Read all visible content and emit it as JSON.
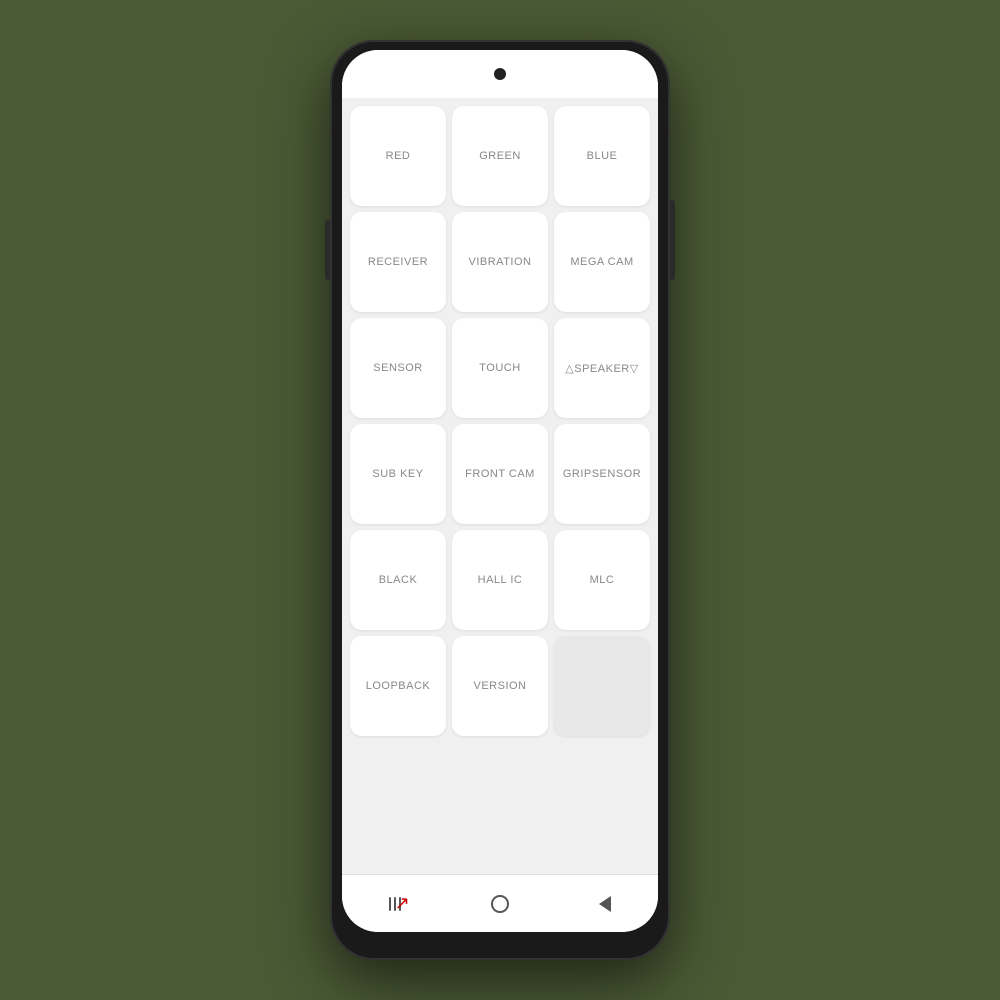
{
  "phone": {
    "background": "#4a5a35"
  },
  "grid": {
    "items": [
      {
        "id": "red",
        "label": "RED",
        "empty": false
      },
      {
        "id": "green",
        "label": "GREEN",
        "empty": false
      },
      {
        "id": "blue",
        "label": "BLUE",
        "empty": false
      },
      {
        "id": "receiver",
        "label": "RECEIVER",
        "empty": false
      },
      {
        "id": "vibration",
        "label": "VIBRATION",
        "empty": false
      },
      {
        "id": "mega-cam",
        "label": "MEGA CAM",
        "empty": false
      },
      {
        "id": "sensor",
        "label": "SENSOR",
        "empty": false
      },
      {
        "id": "touch",
        "label": "TOUCH",
        "empty": false
      },
      {
        "id": "speaker",
        "label": "△SPEAKER▽",
        "empty": false
      },
      {
        "id": "sub-key",
        "label": "SUB KEY",
        "empty": false
      },
      {
        "id": "front-cam",
        "label": "FRONT CAM",
        "empty": false
      },
      {
        "id": "gripsensor",
        "label": "GRIPSENSOR",
        "empty": false
      },
      {
        "id": "black",
        "label": "BLACK",
        "empty": false
      },
      {
        "id": "hall-ic",
        "label": "HALL IC",
        "empty": false
      },
      {
        "id": "mlc",
        "label": "MLC",
        "empty": false
      },
      {
        "id": "loopback",
        "label": "LOOPBACK",
        "empty": false
      },
      {
        "id": "version",
        "label": "VERSION",
        "empty": false
      },
      {
        "id": "empty1",
        "label": "",
        "empty": true
      }
    ]
  },
  "navbar": {
    "recent_label": "recent",
    "home_label": "home",
    "back_label": "back"
  }
}
